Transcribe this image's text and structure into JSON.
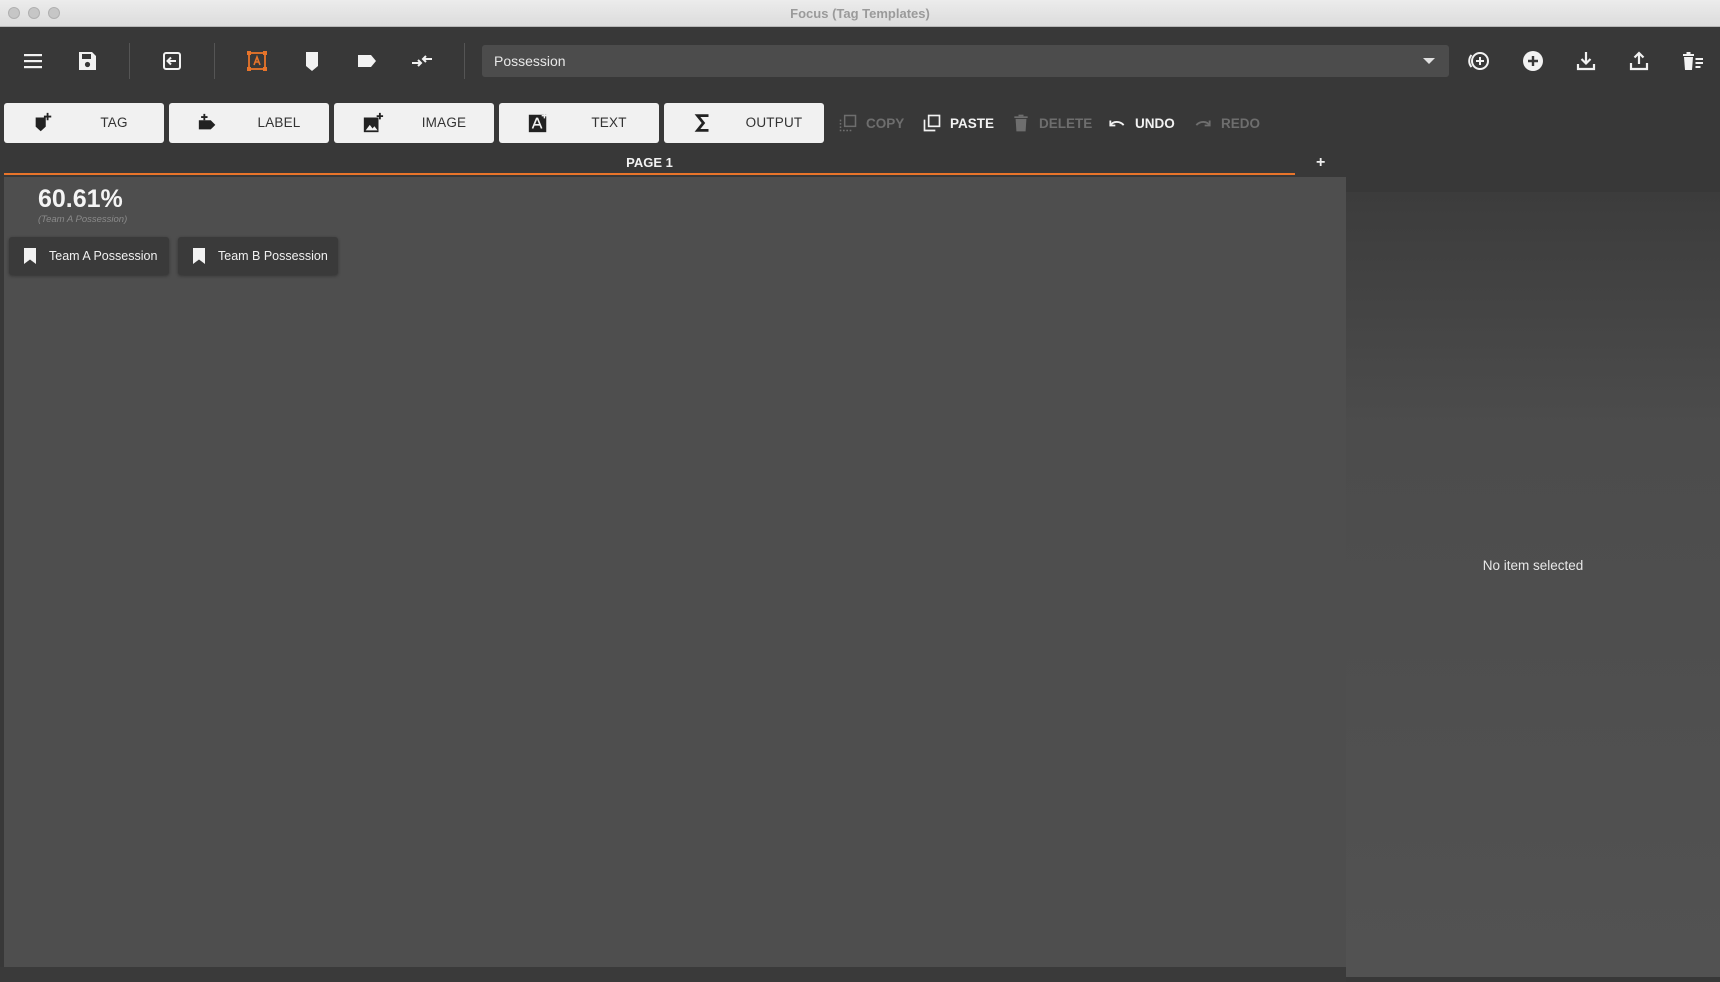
{
  "window": {
    "title": "Focus (Tag Templates)"
  },
  "toolbar": {
    "icons": {
      "menu": "menu-icon",
      "save": "save-icon",
      "exit": "exit-icon",
      "select": "select-tool-icon",
      "tag": "tag-icon",
      "label": "label-icon",
      "link": "link-icon",
      "add_circle_outline": "add-circle-outline-icon",
      "add_circle": "add-circle-icon",
      "download": "download-icon",
      "upload": "upload-icon",
      "delete_list": "delete-list-icon"
    },
    "template_select": {
      "value": "Possession"
    }
  },
  "ribbon": {
    "buttons": [
      {
        "label": "TAG",
        "icon": "add-tag-icon"
      },
      {
        "label": "LABEL",
        "icon": "add-label-icon"
      },
      {
        "label": "IMAGE",
        "icon": "add-image-icon"
      },
      {
        "label": "TEXT",
        "icon": "add-text-icon"
      },
      {
        "label": "OUTPUT",
        "icon": "sigma-icon"
      }
    ],
    "actions": [
      {
        "label": "COPY",
        "icon": "copy-icon",
        "enabled": false
      },
      {
        "label": "PASTE",
        "icon": "paste-icon",
        "enabled": true
      },
      {
        "label": "DELETE",
        "icon": "trash-icon",
        "enabled": false
      },
      {
        "label": "UNDO",
        "icon": "undo-icon",
        "enabled": true
      },
      {
        "label": "REDO",
        "icon": "redo-icon",
        "enabled": false
      }
    ]
  },
  "tabs": {
    "active": "PAGE 1",
    "add_label": "+"
  },
  "canvas": {
    "output_value": "60.61%",
    "output_caption": "(Team A Possession)",
    "tag_buttons": [
      {
        "label": "Team A Possession",
        "icon": "bookmark-icon"
      },
      {
        "label": "Team B Possession",
        "icon": "bookmark-icon"
      }
    ]
  },
  "side_panel": {
    "message": "No item selected"
  },
  "colors": {
    "accent": "#e8742a",
    "background": "#383838",
    "canvas": "#4e4e4e",
    "button_bg": "#f1f1f1"
  }
}
